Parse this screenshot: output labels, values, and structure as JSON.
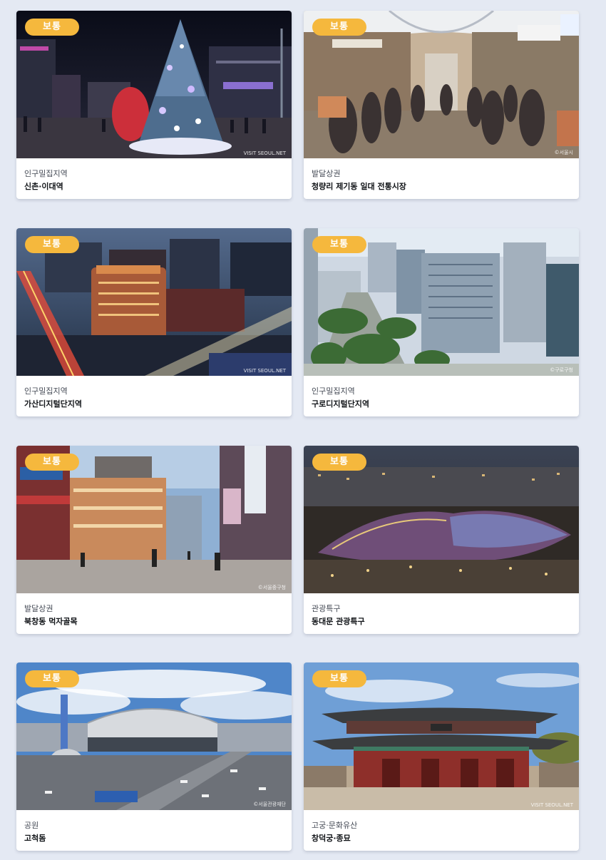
{
  "cards": [
    {
      "badge": "보통",
      "category": "인구밀집지역",
      "name": "신촌·이대역",
      "watermark": "VISIT SEOUL.NET"
    },
    {
      "badge": "보통",
      "category": "발달상권",
      "name": "청량리 제기동 일대 전통시장",
      "watermark": "©서울시"
    },
    {
      "badge": "보통",
      "category": "인구밀집지역",
      "name": "가산디지털단지역",
      "watermark": "VISIT SEOUL.NET"
    },
    {
      "badge": "보통",
      "category": "인구밀집지역",
      "name": "구로디지털단지역",
      "watermark": "©구로구청"
    },
    {
      "badge": "보통",
      "category": "발달상권",
      "name": "북창동 먹자골목",
      "watermark": "©서울중구청"
    },
    {
      "badge": "보통",
      "category": "관광특구",
      "name": "동대문 관광특구",
      "watermark": ""
    },
    {
      "badge": "보통",
      "category": "공원",
      "name": "고척돔",
      "watermark": "©서울관광재단"
    },
    {
      "badge": "보통",
      "category": "고궁·문화유산",
      "name": "창덕궁·종묘",
      "watermark": "VISIT SEOUL.NET"
    }
  ],
  "colors": {
    "page_bg": "#e4e9f3",
    "badge_bg": "#f5b83d",
    "badge_text": "#ffffff",
    "card_bg": "#ffffff"
  }
}
